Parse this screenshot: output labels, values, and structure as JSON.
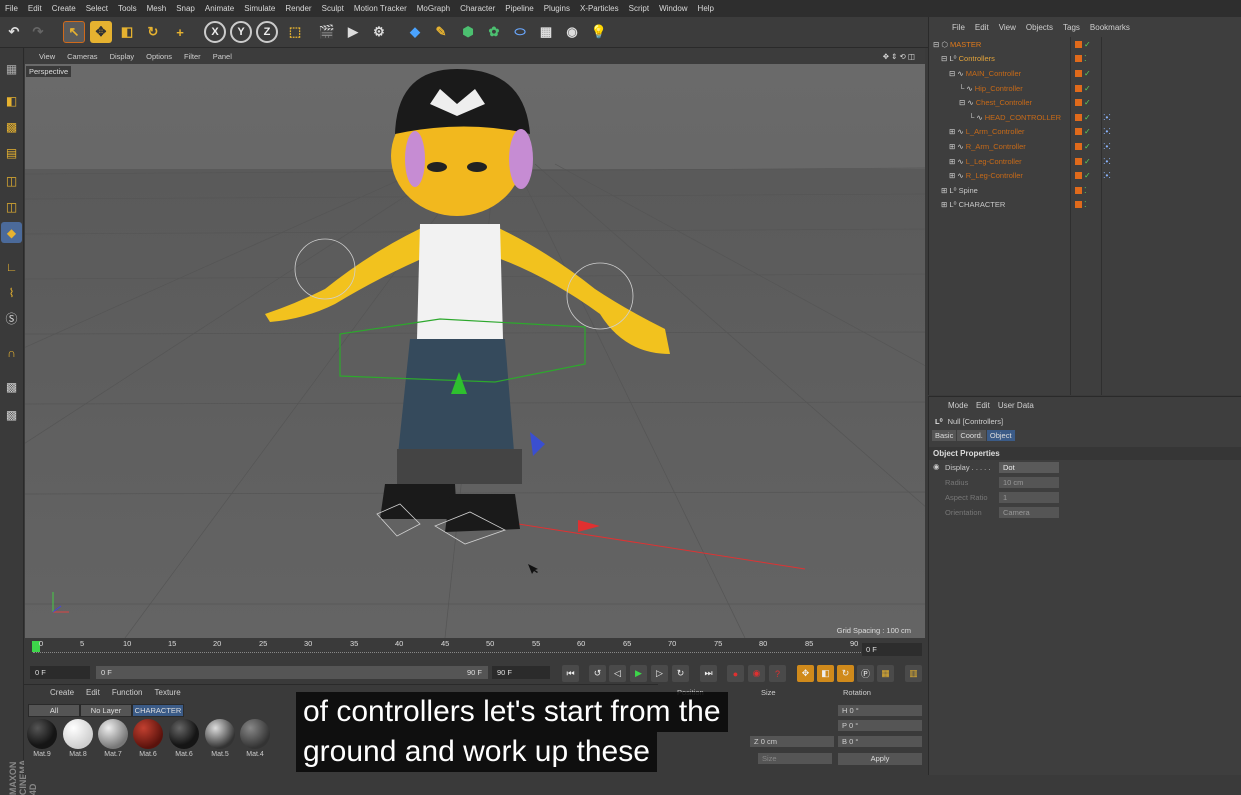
{
  "menu": [
    "File",
    "Edit",
    "Create",
    "Select",
    "Tools",
    "Mesh",
    "Snap",
    "Animate",
    "Simulate",
    "Render",
    "Sculpt",
    "Motion Tracker",
    "MoGraph",
    "Character",
    "Pipeline",
    "Plugins",
    "X-Particles",
    "Script",
    "Window",
    "Help"
  ],
  "axis_buttons": [
    "X",
    "Y",
    "Z"
  ],
  "viewport": {
    "menu": [
      "View",
      "Cameras",
      "Display",
      "Options",
      "Filter",
      "Panel"
    ],
    "label": "Perspective",
    "grid_spacing": "Grid Spacing : 100 cm"
  },
  "timeline": {
    "ticks": [
      "0",
      "5",
      "10",
      "15",
      "20",
      "25",
      "30",
      "35",
      "40",
      "45",
      "50",
      "55",
      "60",
      "65",
      "70",
      "75",
      "80",
      "85",
      "90"
    ],
    "current_frame": "0 F",
    "start": "0 F",
    "min": "0 F",
    "max": "90 F",
    "end": "90 F"
  },
  "materials": {
    "menu": [
      "Create",
      "Edit",
      "Function",
      "Texture"
    ],
    "filters": [
      "All",
      "No Layer",
      "CHARACTER"
    ],
    "items": [
      {
        "name": "Mat.9",
        "color": "#151515"
      },
      {
        "name": "Mat.8",
        "color": "#f2f2f2"
      },
      {
        "name": "Mat.7",
        "color": "#a8a8a8"
      },
      {
        "name": "Mat.6",
        "color": "#7a1a12"
      },
      {
        "name": "Mat.6",
        "color": "#1e1e1e"
      },
      {
        "name": "Mat.5",
        "color": "#6f6f6f"
      },
      {
        "name": "Mat.4",
        "color": "#555555"
      }
    ]
  },
  "coords": {
    "headers": [
      "Position",
      "Size",
      "Rotation"
    ],
    "rows": [
      [
        "H",
        "0 °"
      ],
      [
        "P",
        "0 °"
      ],
      [
        "B",
        "0 °"
      ]
    ],
    "z_label": "Z",
    "z_value": "0 cm",
    "size_mode": "Size",
    "apply": "Apply"
  },
  "brand": "MAXON CINEMA 4D",
  "objects": {
    "menu": [
      "File",
      "Edit",
      "View",
      "Objects",
      "Tags",
      "Bookmarks"
    ],
    "items": [
      {
        "name": "MASTER",
        "indent": 0,
        "color": "#e07a1b",
        "tags": false
      },
      {
        "name": "Controllers",
        "indent": 1,
        "color": "#e3a43b",
        "tags": false
      },
      {
        "name": "MAIN_Controller",
        "indent": 2,
        "color": "#c76a18",
        "tags": false
      },
      {
        "name": "Hip_Controller",
        "indent": 3,
        "color": "#c76a18",
        "tags": false
      },
      {
        "name": "Chest_Controller",
        "indent": 3,
        "color": "#c76a18",
        "tags": false
      },
      {
        "name": "HEAD_CONTROLLER",
        "indent": 4,
        "color": "#c76a18",
        "tags": true
      },
      {
        "name": "L_Arm_Controller",
        "indent": 2,
        "color": "#c76a18",
        "tags": true
      },
      {
        "name": "R_Arm_Controller",
        "indent": 2,
        "color": "#c76a18",
        "tags": true
      },
      {
        "name": "L_Leg-Controller",
        "indent": 2,
        "color": "#c76a18",
        "tags": true
      },
      {
        "name": "R_Leg-Controller",
        "indent": 2,
        "color": "#c76a18",
        "tags": true
      },
      {
        "name": "Spine",
        "indent": 1,
        "color": "#c8c8c8",
        "tags": false
      },
      {
        "name": "CHARACTER",
        "indent": 1,
        "color": "#c8c8c8",
        "tags": false
      }
    ]
  },
  "attributes": {
    "menu": [
      "Mode",
      "Edit",
      "User Data"
    ],
    "title": "Null [Controllers]",
    "tabs": [
      "Basic",
      "Coord.",
      "Object"
    ],
    "section": "Object Properties",
    "props": [
      {
        "label": "Display . . . . .",
        "value": "Dot"
      },
      {
        "label": "Radius",
        "value": "10 cm"
      },
      {
        "label": "Aspect Ratio",
        "value": "1"
      },
      {
        "label": "Orientation",
        "value": "Camera"
      }
    ]
  },
  "subtitle": {
    "line1": "of controllers let's start from the",
    "line2": "ground and work up these"
  }
}
